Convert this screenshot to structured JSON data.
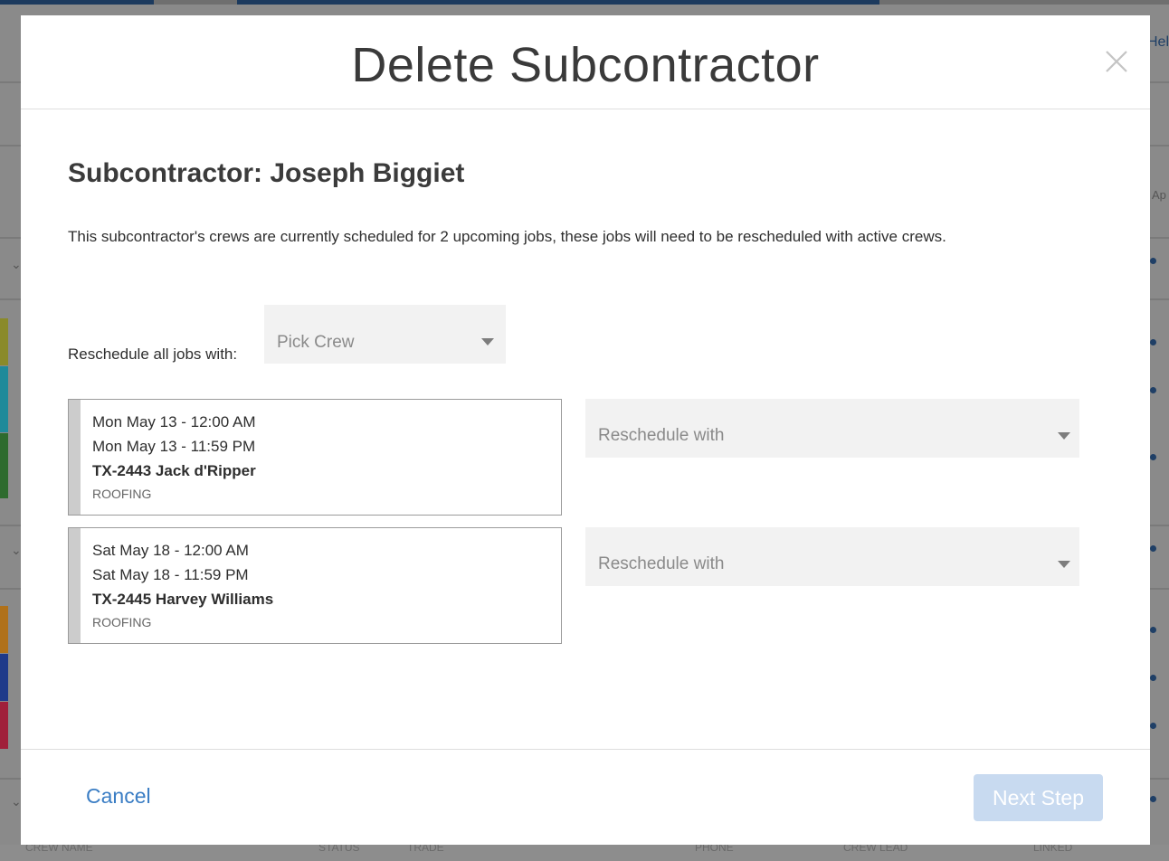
{
  "background": {
    "help_fragment": "Hel",
    "ap_fragment": "Ap",
    "footer_columns": [
      "CREW NAME",
      "STATUS",
      "TRADE",
      "PHONE",
      "CREW LEAD",
      "LINKED"
    ],
    "strip_colors": [
      "#8a8a2a",
      "#1f8a9a",
      "#2e6b2e",
      "#b0711a",
      "#1f3a8a",
      "#a0203a"
    ]
  },
  "modal": {
    "title": "Delete Subcontractor",
    "close_icon": "close-icon",
    "subcontractor_heading": "Subcontractor: Joseph Biggiet",
    "description": "This subcontractor's crews are currently scheduled for 2 upcoming jobs, these jobs will need to be rescheduled with active crews.",
    "reschedule_all_label": "Reschedule all jobs with:",
    "pick_crew_placeholder": "Pick Crew",
    "jobs": [
      {
        "start": "Mon May 13 - 12:00 AM",
        "end": "Mon May 13 - 11:59 PM",
        "name": "TX-2443 Jack d'Ripper",
        "trade": "ROOFING",
        "reschedule_placeholder": "Reschedule with"
      },
      {
        "start": "Sat May 18 - 12:00 AM",
        "end": "Sat May 18 - 11:59 PM",
        "name": "TX-2445 Harvey Williams",
        "trade": "ROOFING",
        "reschedule_placeholder": "Reschedule with"
      }
    ],
    "cancel_label": "Cancel",
    "next_label": "Next Step"
  }
}
